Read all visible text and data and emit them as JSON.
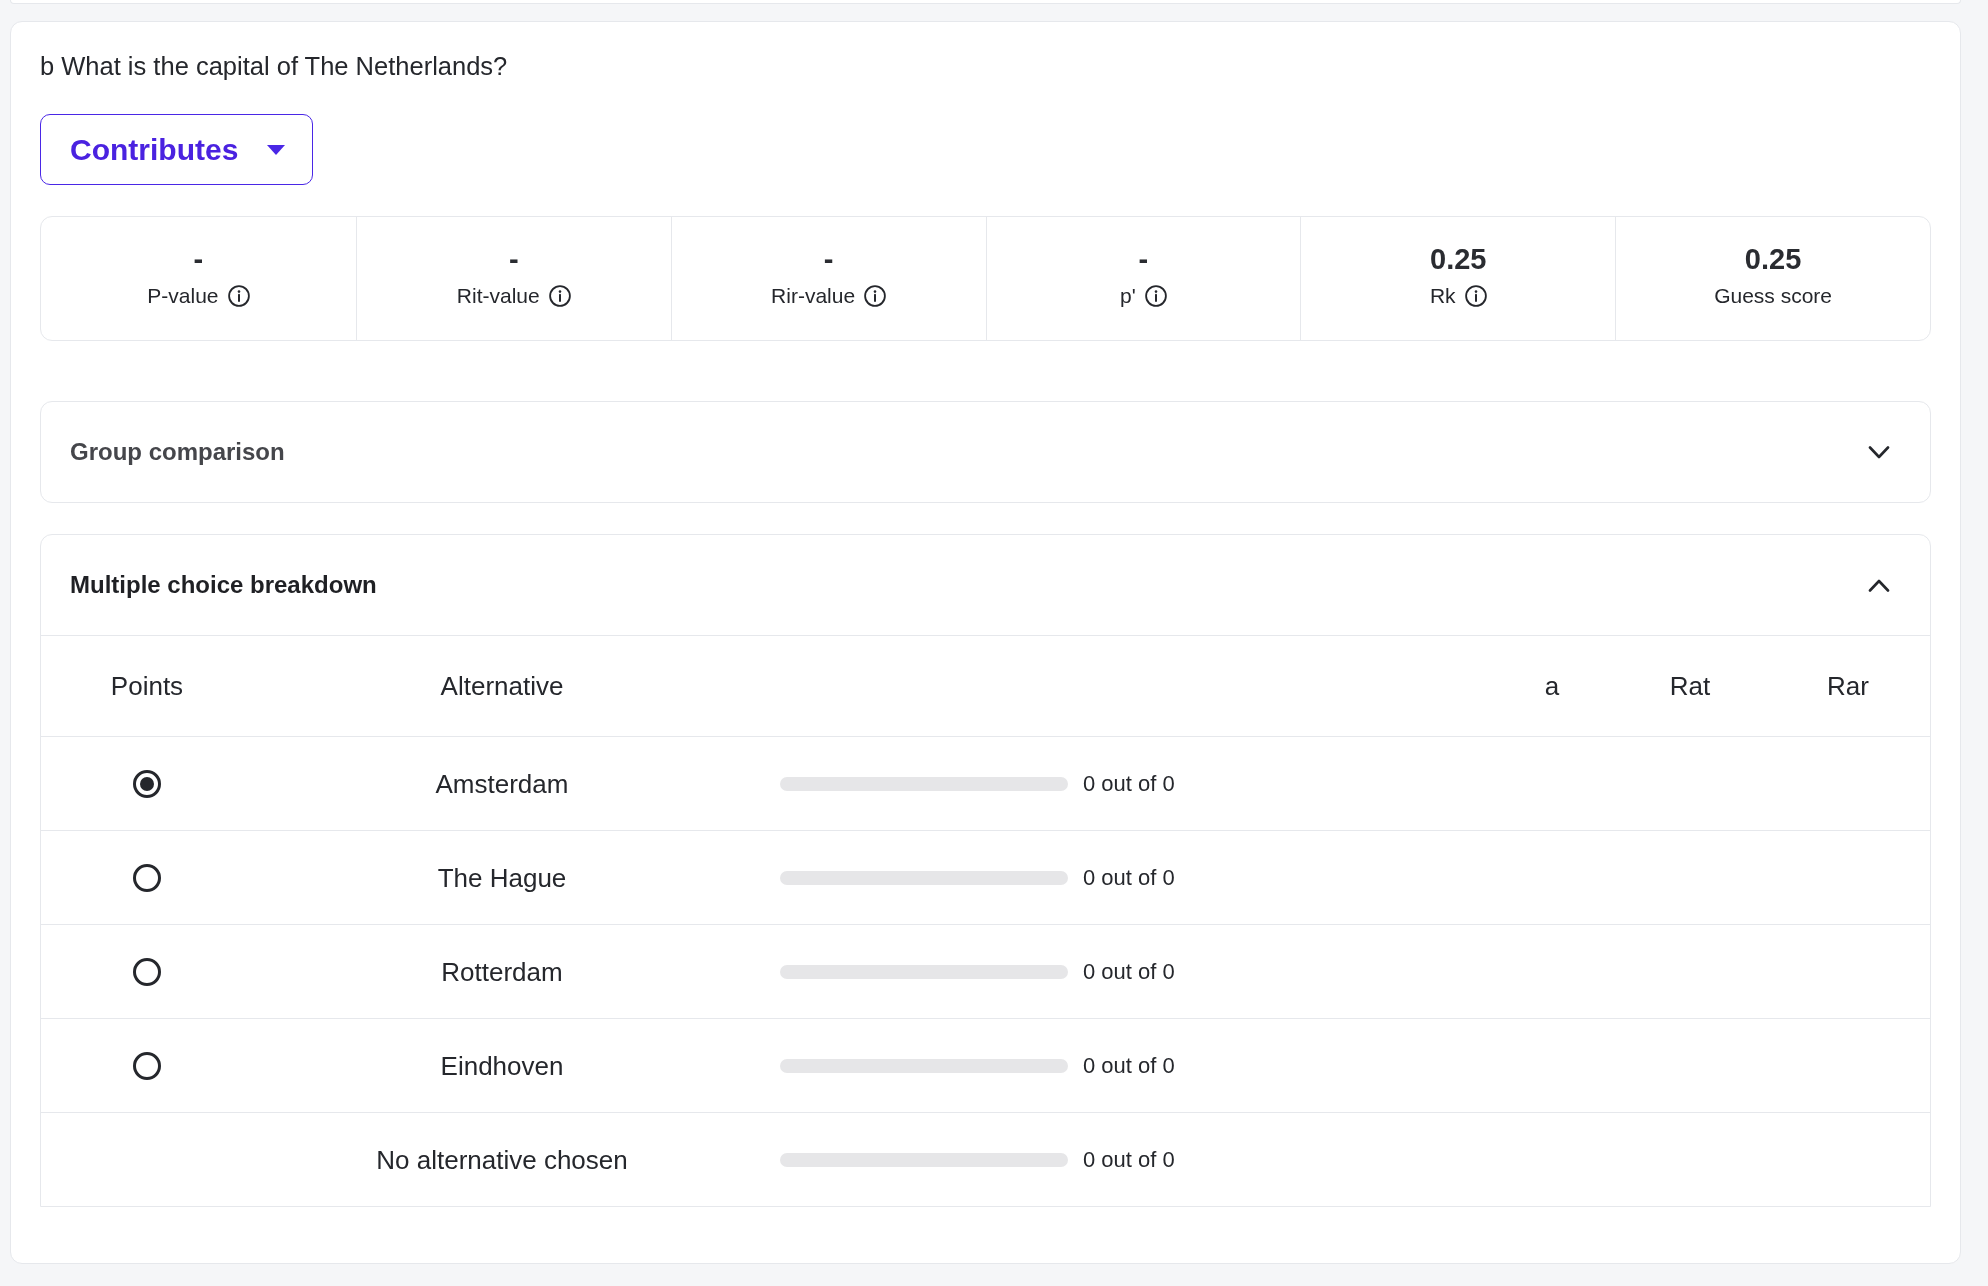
{
  "question": {
    "text": "b What is the capital of The Netherlands?"
  },
  "dropdown": {
    "label": "Contributes"
  },
  "stats": [
    {
      "value": "-",
      "label": "P-value",
      "info": true
    },
    {
      "value": "-",
      "label": "Rit-value",
      "info": true
    },
    {
      "value": "-",
      "label": "Rir-value",
      "info": true
    },
    {
      "value": "-",
      "label": "p'",
      "info": true
    },
    {
      "value": "0.25",
      "label": "Rk",
      "info": true
    },
    {
      "value": "0.25",
      "label": "Guess score",
      "info": false
    }
  ],
  "sections": [
    {
      "title": "Group comparison",
      "expanded": false
    },
    {
      "title": "Multiple choice breakdown",
      "expanded": true,
      "table": {
        "columns": [
          {
            "label": "Points"
          },
          {
            "label": "Alternative"
          },
          {
            "label": "a"
          },
          {
            "label": "Rat"
          },
          {
            "label": "Rar"
          }
        ],
        "rows": [
          {
            "kind": "option",
            "selected": true,
            "alternative": "Amsterdam",
            "level": 0,
            "count": "0 out of 0"
          },
          {
            "kind": "option",
            "selected": false,
            "alternative": "The Hague",
            "level": 0,
            "count": "0 out of 0"
          },
          {
            "kind": "option",
            "selected": false,
            "alternative": "Rotterdam",
            "level": 0,
            "count": "0 out of 0"
          },
          {
            "kind": "option",
            "selected": false,
            "alternative": "Eindhoven",
            "level": 0,
            "count": "0 out of 0"
          },
          {
            "kind": "none",
            "alternative": "No alternative chosen",
            "level": 0,
            "count": "0 out of 0"
          }
        ]
      }
    }
  ]
}
